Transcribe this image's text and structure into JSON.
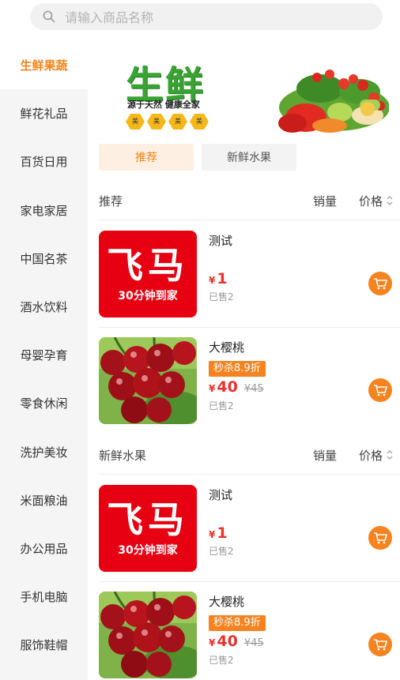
{
  "search": {
    "placeholder": "请输入商品名称"
  },
  "sidebar": {
    "items": [
      {
        "label": "生鲜果蔬",
        "active": true
      },
      {
        "label": "鲜花礼品"
      },
      {
        "label": "百货日用"
      },
      {
        "label": "家电家居"
      },
      {
        "label": "中国名茶"
      },
      {
        "label": "酒水饮料"
      },
      {
        "label": "母婴孕育"
      },
      {
        "label": "零食休闲"
      },
      {
        "label": "洗护美妆"
      },
      {
        "label": "米面粮油"
      },
      {
        "label": "办公用品"
      },
      {
        "label": "手机电脑"
      },
      {
        "label": "服饰鞋帽"
      }
    ]
  },
  "banner": {
    "title": "生鲜",
    "slogan": "源于天然 健康全家",
    "hexagons": [
      "美",
      "美",
      "美",
      "美"
    ]
  },
  "tabs": [
    {
      "label": "推荐",
      "active": true
    },
    {
      "label": "新鲜水果"
    }
  ],
  "sections": [
    {
      "title": "推荐",
      "sort_sales": "销量",
      "sort_price": "价格",
      "products": [
        {
          "name": "测试",
          "price_symbol": "¥",
          "price": "1",
          "sold": "已售2",
          "logo_big": "飞马",
          "logo_small": "30分钟到家"
        },
        {
          "name": "大樱桃",
          "badge": "秒杀8.9折",
          "price_symbol": "¥",
          "price": "40",
          "orig_price": "¥45",
          "sold": "已售2"
        }
      ]
    },
    {
      "title": "新鲜水果",
      "sort_sales": "销量",
      "sort_price": "价格",
      "products": [
        {
          "name": "测试",
          "price_symbol": "¥",
          "price": "1",
          "sold": "已售2",
          "logo_big": "飞马",
          "logo_small": "30分钟到家"
        },
        {
          "name": "大樱桃",
          "badge": "秒杀8.9折",
          "price_symbol": "¥",
          "price": "40",
          "orig_price": "¥45",
          "sold": "已售2"
        }
      ]
    }
  ],
  "colors": {
    "accent": "#f08519",
    "price": "#e8322a",
    "cart": "#f5831f"
  }
}
